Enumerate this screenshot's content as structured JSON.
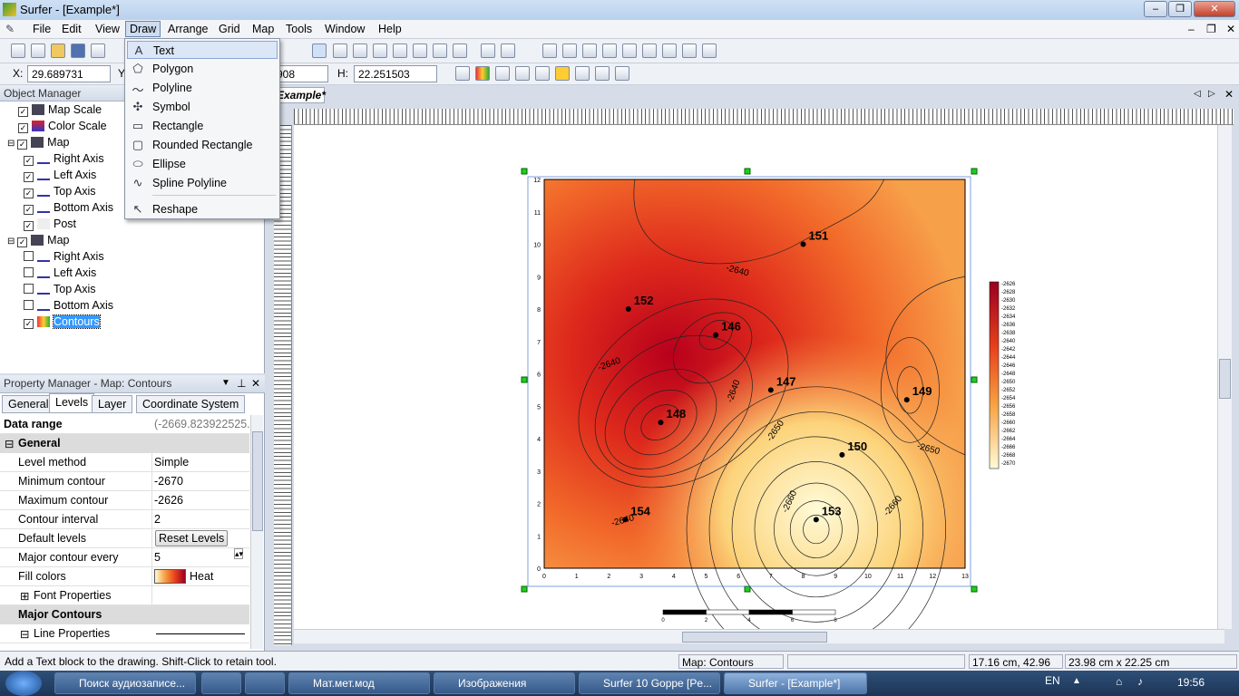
{
  "window": {
    "title": "Surfer - [Example*]",
    "min": "–",
    "max": "❐",
    "close": "✕"
  },
  "menu": [
    "File",
    "Edit",
    "View",
    "Draw",
    "Arrange",
    "Grid",
    "Map",
    "Tools",
    "Window",
    "Help"
  ],
  "coords": {
    "x_label": "X:",
    "x_value": "29.689731",
    "y_label": "Y:",
    "w_value": "908",
    "h_label": "H:",
    "h_value": "22.251503"
  },
  "object_manager": {
    "title": "Object Manager",
    "items": [
      {
        "label": "Map Scale",
        "level": 0,
        "checked": true
      },
      {
        "label": "Color Scale",
        "level": 0,
        "checked": true
      },
      {
        "label": "Map",
        "level": 0,
        "checked": true
      },
      {
        "label": "Right Axis",
        "level": 1,
        "checked": true
      },
      {
        "label": "Left Axis",
        "level": 1,
        "checked": true
      },
      {
        "label": "Top Axis",
        "level": 1,
        "checked": true
      },
      {
        "label": "Bottom Axis",
        "level": 1,
        "checked": true
      },
      {
        "label": "Post",
        "level": 1,
        "checked": true
      },
      {
        "label": "Map",
        "level": 0,
        "checked": true
      },
      {
        "label": "Right Axis",
        "level": 1,
        "checked": false
      },
      {
        "label": "Left Axis",
        "level": 1,
        "checked": false
      },
      {
        "label": "Top Axis",
        "level": 1,
        "checked": false
      },
      {
        "label": "Bottom Axis",
        "level": 1,
        "checked": false
      },
      {
        "label": "Contours",
        "level": 1,
        "checked": true,
        "selected": true
      }
    ]
  },
  "property_manager": {
    "title": "Property Manager - Map: Contours",
    "tabs": [
      "General",
      "Levels",
      "Layer",
      "Coordinate System"
    ],
    "data_range_label": "Data range",
    "data_range_value": "(-2669.823922525...",
    "section_general": "General",
    "rows": [
      {
        "k": "Level method",
        "v": "Simple"
      },
      {
        "k": "Minimum contour",
        "v": "-2670"
      },
      {
        "k": "Maximum contour",
        "v": "-2626"
      },
      {
        "k": "Contour interval",
        "v": "2"
      },
      {
        "k": "Default levels",
        "v": "Reset Levels"
      },
      {
        "k": "Major contour every",
        "v": "5"
      },
      {
        "k": "Fill colors",
        "v": "Heat"
      },
      {
        "k": "Font Properties",
        "v": ""
      }
    ],
    "section_major": "Major Contours",
    "line_props": "Line Properties"
  },
  "document": {
    "tab": "Example*"
  },
  "draw_menu": [
    {
      "label": "Text",
      "icon": "A"
    },
    {
      "label": "Polygon",
      "icon": "⬠"
    },
    {
      "label": "Polyline",
      "icon": "〜"
    },
    {
      "label": "Symbol",
      "icon": "✣"
    },
    {
      "label": "Rectangle",
      "icon": "▭"
    },
    {
      "label": "Rounded Rectangle",
      "icon": "▢"
    },
    {
      "label": "Ellipse",
      "icon": "⬭"
    },
    {
      "label": "Spline Polyline",
      "icon": "∿"
    },
    {
      "label": "Reshape",
      "icon": "↖"
    }
  ],
  "map": {
    "x_ticks": [
      "0",
      "1",
      "2",
      "3",
      "4",
      "5",
      "6",
      "7",
      "8",
      "9",
      "10",
      "11",
      "12",
      "13"
    ],
    "y_ticks": [
      "0",
      "1",
      "2",
      "3",
      "4",
      "5",
      "6",
      "7",
      "8",
      "9",
      "10",
      "11",
      "12"
    ],
    "posts": [
      {
        "id": "151",
        "x": 8,
        "y": 10
      },
      {
        "id": "152",
        "x": 2.6,
        "y": 8
      },
      {
        "id": "146",
        "x": 5.3,
        "y": 7.2
      },
      {
        "id": "147",
        "x": 7,
        "y": 5.5
      },
      {
        "id": "148",
        "x": 3.6,
        "y": 4.5
      },
      {
        "id": "149",
        "x": 11.2,
        "y": 5.2
      },
      {
        "id": "150",
        "x": 9.2,
        "y": 3.5
      },
      {
        "id": "153",
        "x": 8.4,
        "y": 1.5
      },
      {
        "id": "154",
        "x": 2.5,
        "y": 1.5
      }
    ],
    "contour_labels": [
      "-2640",
      "-2640",
      "-2640",
      "-2650",
      "-2660",
      "-2650",
      "-2660",
      "-2640"
    ],
    "colorscale": [
      "-2626",
      "-2628",
      "-2630",
      "-2632",
      "-2634",
      "-2636",
      "-2638",
      "-2640",
      "-2642",
      "-2644",
      "-2646",
      "-2648",
      "-2650",
      "-2652",
      "-2654",
      "-2656",
      "-2658",
      "-2660",
      "-2662",
      "-2664",
      "-2666",
      "-2668",
      "-2670"
    ],
    "scalebar": [
      "0",
      "2",
      "4",
      "6",
      "8"
    ]
  },
  "status": {
    "hint": "Add a Text block to the drawing.  Shift-Click to retain tool.",
    "selection": "Map: Contours",
    "position": "17.16 cm, 42.96 cm",
    "size": "23.98 cm x 22.25 cm"
  },
  "taskbar": {
    "items": [
      "Поиск аудиозаписе...",
      "",
      "",
      "Мат.мет.мод",
      "Изображения",
      "Surfer 10 Goppe [Pe...",
      "Surfer - [Example*]"
    ],
    "lang": "EN",
    "time": "19:56"
  }
}
